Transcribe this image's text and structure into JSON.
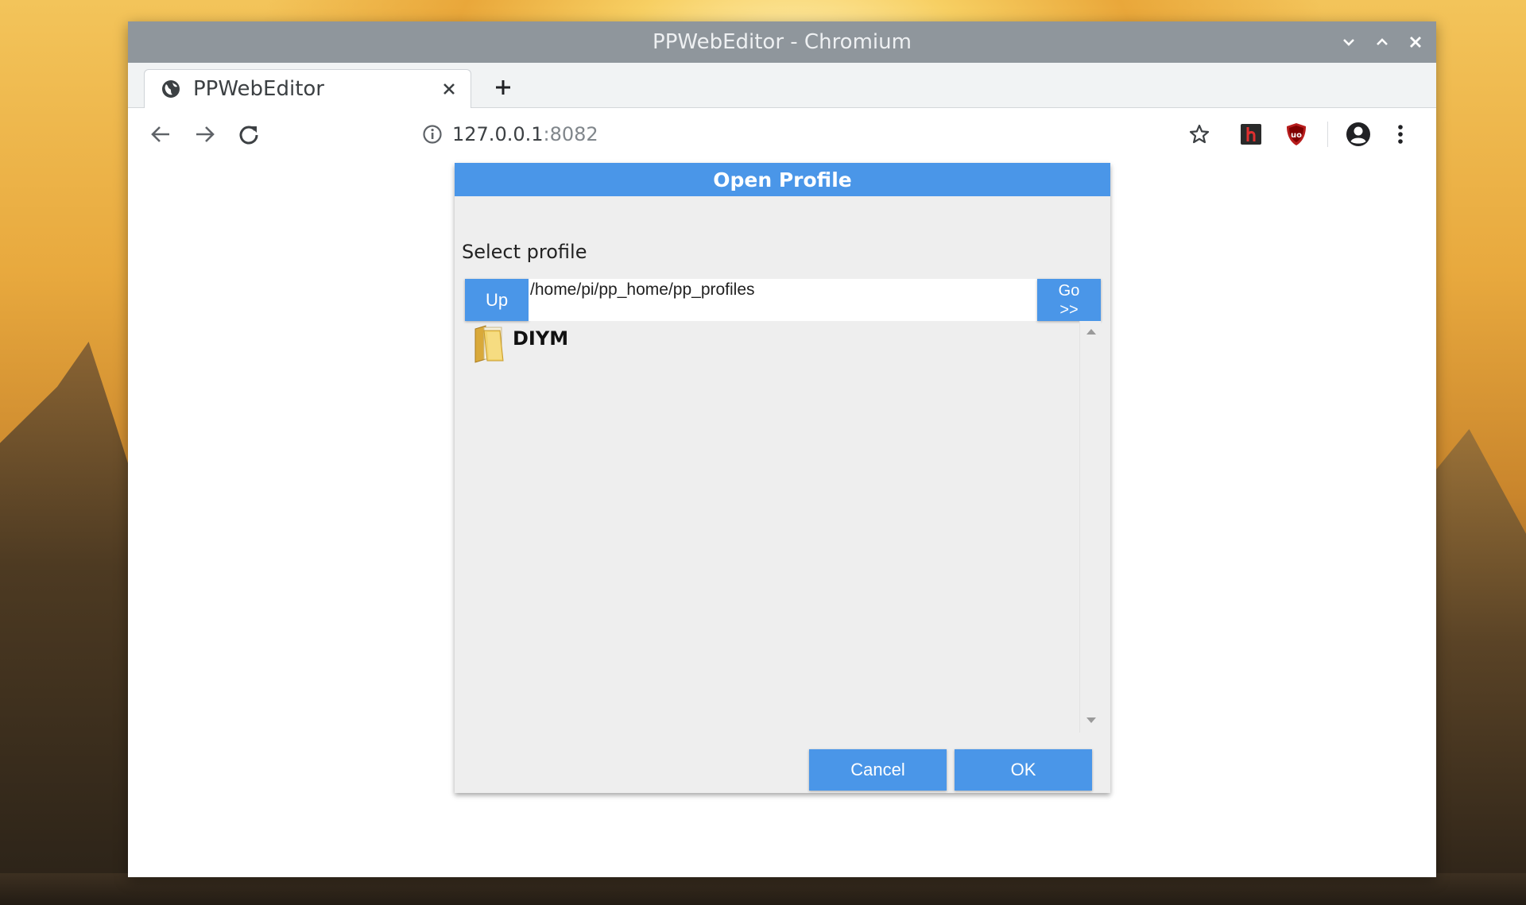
{
  "window": {
    "title": "PPWebEditor - Chromium"
  },
  "tabs": [
    {
      "label": "PPWebEditor",
      "icon": "globe-icon"
    }
  ],
  "toolbar": {
    "url_host": "127.0.0.1",
    "url_port": ":8082"
  },
  "dialog": {
    "title": "Open Profile",
    "select_label": "Select profile",
    "path": "/home/pi/pp_home/pp_profiles",
    "up_label": "Up",
    "go_label_line1": "Go",
    "go_label_line2": ">>",
    "items": [
      {
        "name": "DIYM",
        "icon": "folder-icon"
      }
    ],
    "cancel_label": "Cancel",
    "ok_label": "OK"
  },
  "colors": {
    "dialog_header": "#4a96e8",
    "button_blue": "#4a96e8",
    "titlebar": "#8f969c"
  }
}
